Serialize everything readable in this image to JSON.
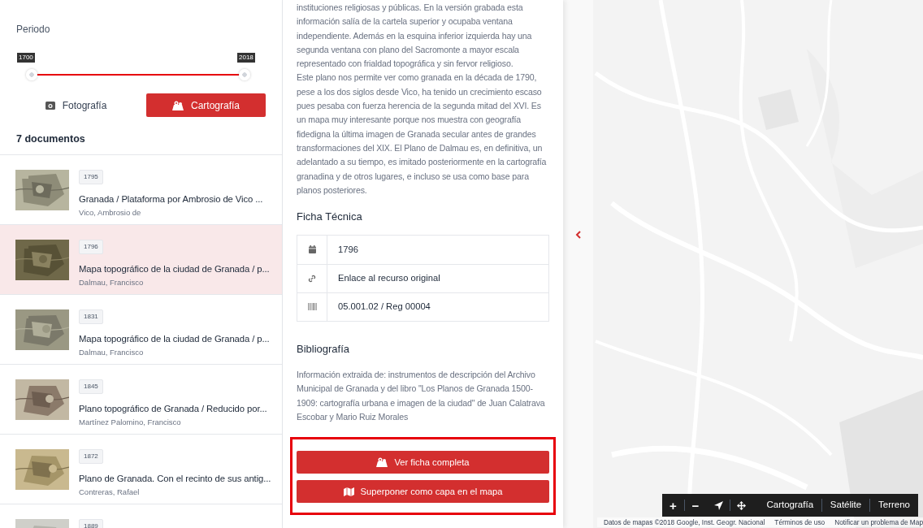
{
  "filters": {
    "period_label": "Periodo",
    "range": [
      {
        "label": "1700",
        "level": 0
      },
      {
        "label": "2018",
        "level": 1
      }
    ]
  },
  "type_tabs": [
    {
      "label": "Fotografía",
      "selected": false
    },
    {
      "label": "Cartografía",
      "kind": "cartography",
      "selected": true
    }
  ],
  "results_count": "7 documentos",
  "documents": [
    {
      "year": "1795",
      "title": "Granada / Plataforma por Ambrosio de Vico ...",
      "author": "Vico, Ambrosio de",
      "selected": false
    },
    {
      "year": "1796",
      "title": "Mapa topográfico de la ciudad de Granada / p...",
      "author": "Dalmau, Francisco",
      "selected": true
    },
    {
      "year": "1831",
      "title": "Mapa topográfico de la ciudad de Granada / p...",
      "author": "Dalmau, Francisco",
      "selected": false
    },
    {
      "year": "1845",
      "title": "Plano topográfico de Granada / Reducido por...",
      "author": "Martínez Palomino, Francisco",
      "selected": false
    },
    {
      "year": "1872",
      "title": "Plano de Granada. Con el recinto de sus antig...",
      "author": "Contreras, Rafael",
      "selected": false
    },
    {
      "year": "1889",
      "selected": false
    }
  ],
  "detail": {
    "description": [
      "instituciones religiosas y públicas. En la versión grabada esta información salía de la cartela superior y ocupaba ventana independiente. Además en la esquina inferior izquierda hay una segunda ventana con plano del Sacromonte a mayor escala representado con frialdad topográfica y sin fervor religioso.",
      "Este plano nos permite ver como granada en la década de 1790, pese a los dos siglos desde Vico, ha tenido un crecimiento escaso pues pesaba con fuerza herencia de la segunda mitad del XVI. Es un mapa muy interesante porque nos muestra con geografía fidedigna la última imagen de Granada secular antes de grandes transformaciones del XIX. El Plano de Dalmau es, en definitiva, un adelantado a su tiempo, es imitado posteriormente en la cartografía granadina y de otros lugares, e incluso se usa como base para planos posteriores."
    ],
    "tech_heading": "Ficha Técnica",
    "tech_rows": [
      {
        "kind": "date",
        "value": "1796"
      },
      {
        "kind": "link",
        "value": "Enlace al recurso original"
      },
      {
        "kind": "code",
        "value": "05.001.02 / Reg 00004"
      }
    ],
    "bib_heading": "Bibliografía",
    "bib_text": "Información extraida de: instrumentos de descripción del Archivo Municipal de Granada y del libro \"Los Planos de Granada 1500-1909: cartografía urbana e imagen de la ciudad\" de Juan Calatrava Escobar y Mario Ruiz Morales",
    "actions": [
      {
        "kind": "sheet",
        "label": "Ver ficha completa"
      },
      {
        "kind": "overlay",
        "label": "Superponer como capa en el mapa"
      }
    ]
  },
  "map": {
    "controls": [
      {
        "kind": "zoom-in",
        "label": "+"
      },
      {
        "kind": "zoom-out",
        "label": "−"
      },
      {
        "kind": "locate"
      },
      {
        "kind": "pan"
      }
    ],
    "map_types": [
      "Cartografía",
      "Satélite",
      "Terreno"
    ],
    "attribution": [
      "Datos de mapas ©2018 Google, Inst. Geogr. Nacional",
      "Términos de uso",
      "Notificar un problema de Map"
    ]
  }
}
